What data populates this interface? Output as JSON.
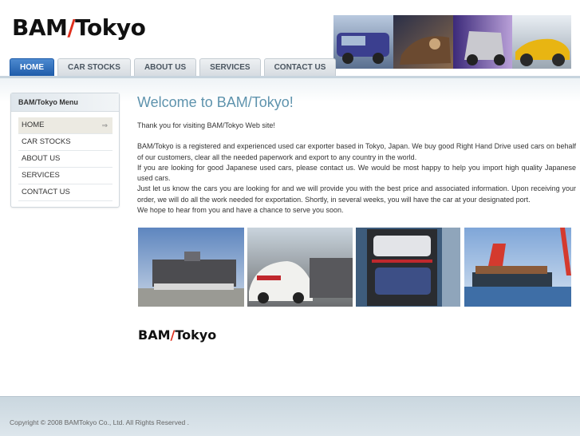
{
  "brand": {
    "part1": "BAM",
    "slash": "/",
    "part2": "Tokyo"
  },
  "nav": {
    "tabs": [
      {
        "label": "HOME"
      },
      {
        "label": "CAR STOCKS"
      },
      {
        "label": "ABOUT US"
      },
      {
        "label": "SERVICES"
      },
      {
        "label": "CONTACT US"
      }
    ]
  },
  "sidebar": {
    "title": "BAM/Tokyo Menu",
    "items": [
      {
        "label": "HOME",
        "arrow": "⇒"
      },
      {
        "label": "CAR STOCKS"
      },
      {
        "label": "ABOUT US"
      },
      {
        "label": "SERVICES"
      },
      {
        "label": "CONTACT US"
      }
    ]
  },
  "main": {
    "title": "Welcome to BAM/Tokyo!",
    "intro": "Thank you for visiting BAM/Tokyo Web site!",
    "para1": "BAM/Tokyo is a registered and experienced used car exporter based in Tokyo, Japan. We buy good Right Hand Drive used cars on behalf of our customers, clear all the needed paperwork and export to any country in the world.",
    "para2": "If you are looking for good Japanese used cars, please contact us. We would be most happy to help you import high quality Japanese used cars.",
    "para3": "Just let us know the cars you are looking for and we will provide you with the best price and associated information. Upon receiving your order, we will do all the work needed for exportation. Shortly, in several weeks, you will have the car at your designated port.",
    "para4": "We hope to hear from you and have a chance to serve you soon."
  },
  "footer": {
    "copyright": "Copyright © 2008 BAMTokyo Co., Ltd. All Rights Reserved ."
  },
  "colors": {
    "active_tab": "#1c5aa8",
    "title": "#5e93ad",
    "brand_slash": "#e0301e"
  }
}
